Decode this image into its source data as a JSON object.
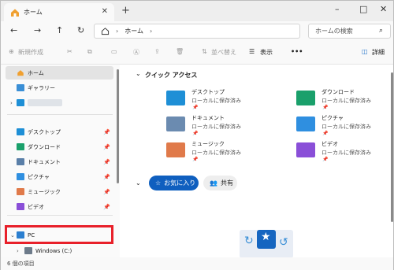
{
  "tab": {
    "title": "ホーム",
    "close_glyph": "✕"
  },
  "window_controls": {
    "minimize": "–",
    "maximize": "□",
    "close": "✕"
  },
  "nav": {
    "back": "←",
    "forward": "→",
    "up": "↑",
    "refresh": "↻"
  },
  "address": {
    "segment": "ホーム",
    "sep1": "›",
    "sep2": "›"
  },
  "search": {
    "placeholder": "ホームの検索"
  },
  "toolbar": {
    "new_label": "新規作成",
    "sort_label": "並べ替え",
    "view_label": "表示",
    "more": "•••",
    "details_label": "詳細"
  },
  "sidebar": {
    "home": "ホーム",
    "gallery": "ギャラリー",
    "pinned": [
      {
        "label": "デスクトップ",
        "color": "#1e8fd6"
      },
      {
        "label": "ダウンロード",
        "color": "#1aa06b"
      },
      {
        "label": "ドキュメント",
        "color": "#5a7fa8"
      },
      {
        "label": "ピクチャ",
        "color": "#2f8fe0"
      },
      {
        "label": "ミュージック",
        "color": "#e07a4a"
      },
      {
        "label": "ビデオ",
        "color": "#8a4fd8"
      }
    ],
    "pc": "PC",
    "drive": "Windows (C:)"
  },
  "quick_access": {
    "title": "クイック アクセス",
    "items": [
      {
        "name": "デスクトップ",
        "sub": "ローカルに保存済み",
        "color": "#1e8fd6"
      },
      {
        "name": "ダウンロード",
        "sub": "ローカルに保存済み",
        "color": "#1aa06b"
      },
      {
        "name": "ドキュメント",
        "sub": "ローカルに保存済み",
        "color": "#6b8bb0"
      },
      {
        "name": "ピクチャ",
        "sub": "ローカルに保存済み",
        "color": "#2f8fe0"
      },
      {
        "name": "ミュージック",
        "sub": "ローカルに保存済み",
        "color": "#e07a4a"
      },
      {
        "name": "ビデオ",
        "sub": "ローカルに保存済み",
        "color": "#8a4fd8"
      }
    ]
  },
  "filters": {
    "favorites": "お気に入り",
    "shared": "共有"
  },
  "status": {
    "count": "6 個の項目"
  }
}
